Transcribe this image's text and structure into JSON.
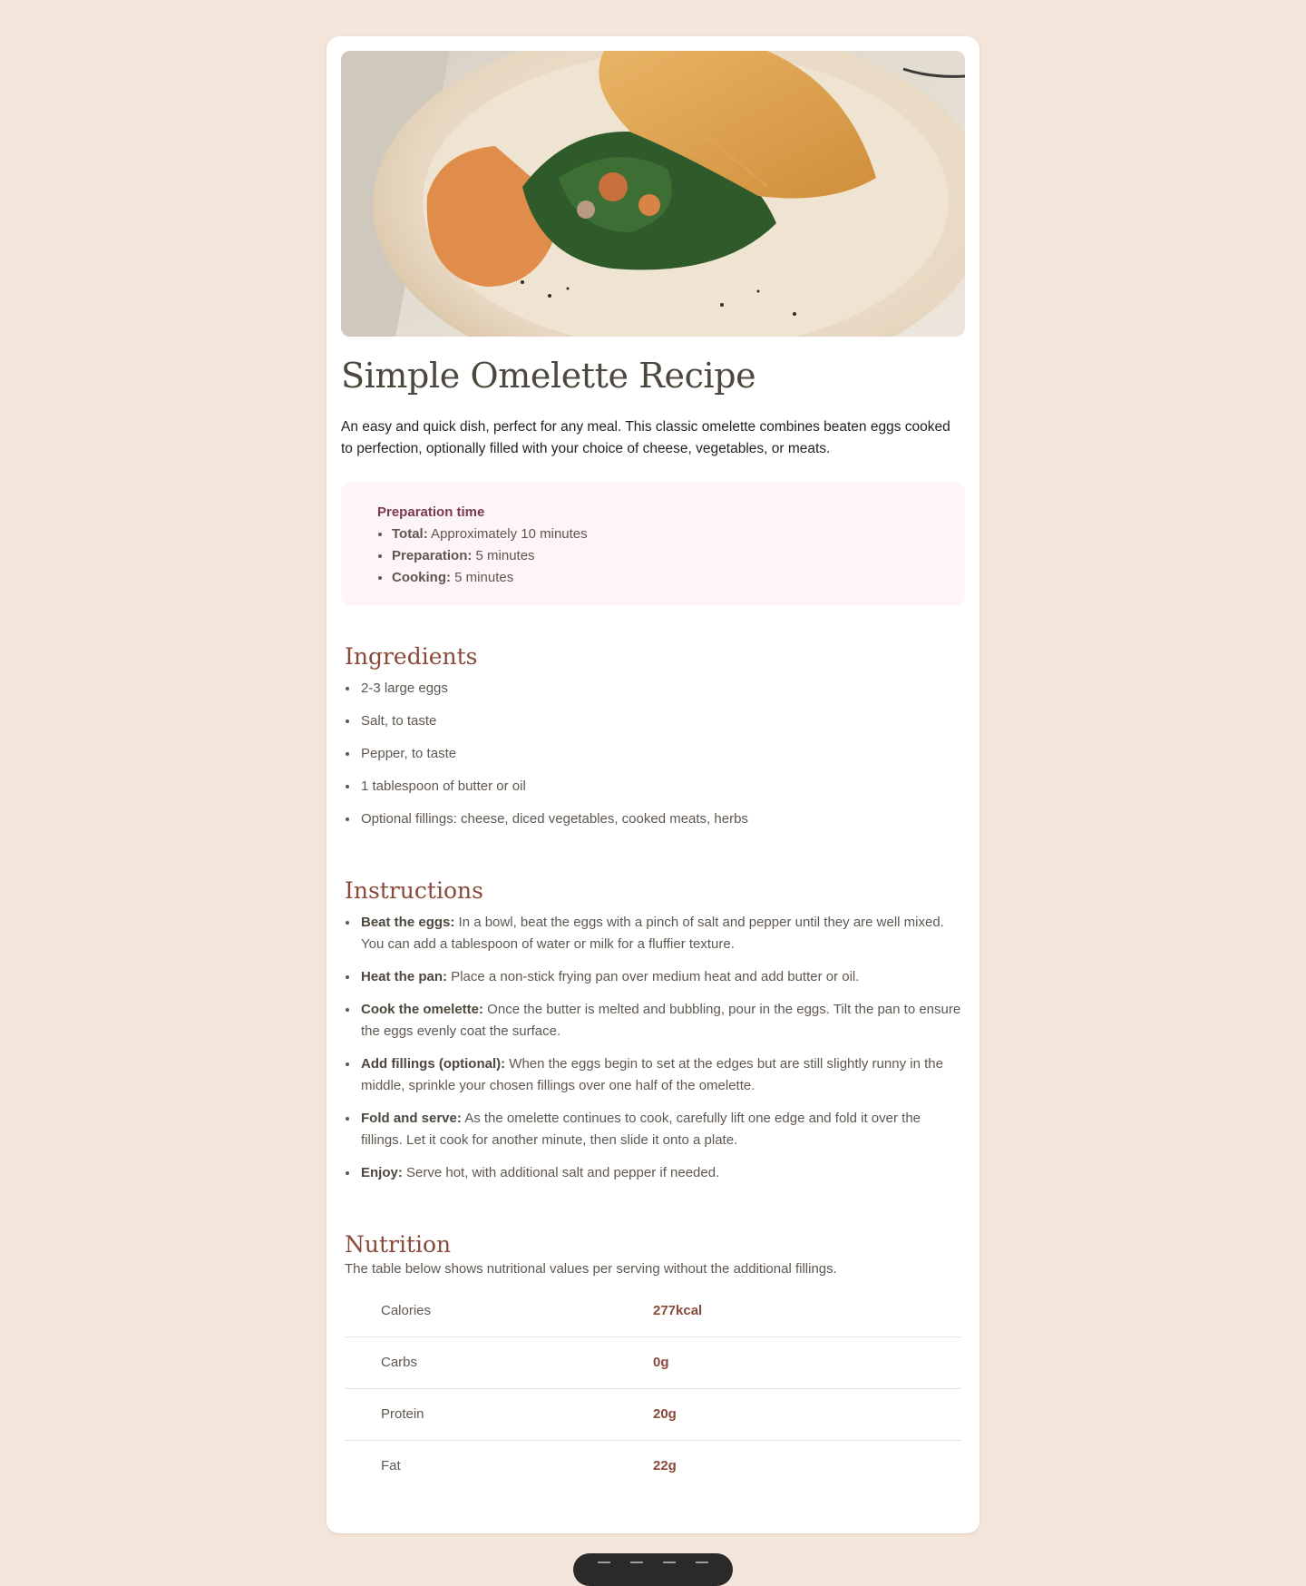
{
  "recipe": {
    "image_alt": "Omelette folded over spinach and fillings on a plate",
    "title": "Simple Omelette Recipe",
    "intro": "An easy and quick dish, perfect for any meal. This classic omelette combines beaten eggs cooked to perfection, optionally filled with your choice of cheese, vegetables, or meats.",
    "prep": {
      "title": "Preparation time",
      "items": [
        {
          "label": "Total:",
          "text": " Approximately 10 minutes"
        },
        {
          "label": "Preparation:",
          "text": " 5 minutes"
        },
        {
          "label": "Cooking:",
          "text": " 5 minutes"
        }
      ]
    },
    "ingredients": {
      "heading": "Ingredients",
      "items": [
        "2-3 large eggs",
        "Salt, to taste",
        "Pepper, to taste",
        "1 tablespoon of butter or oil",
        "Optional fillings: cheese, diced vegetables, cooked meats, herbs"
      ]
    },
    "instructions": {
      "heading": "Instructions",
      "items": [
        {
          "label": "Beat the eggs:",
          "text": " In a bowl, beat the eggs with a pinch of salt and pepper until they are well mixed. You can add a tablespoon of water or milk for a fluffier texture."
        },
        {
          "label": "Heat the pan:",
          "text": " Place a non-stick frying pan over medium heat and add butter or oil."
        },
        {
          "label": "Cook the omelette:",
          "text": " Once the butter is melted and bubbling, pour in the eggs. Tilt the pan to ensure the eggs evenly coat the surface."
        },
        {
          "label": "Add fillings (optional):",
          "text": " When the eggs begin to set at the edges but are still slightly runny in the middle, sprinkle your chosen fillings over one half of the omelette."
        },
        {
          "label": "Fold and serve:",
          "text": " As the omelette continues to cook, carefully lift one edge and fold it over the fillings. Let it cook for another minute, then slide it onto a plate."
        },
        {
          "label": "Enjoy:",
          "text": " Serve hot, with additional salt and pepper if needed."
        }
      ]
    },
    "nutrition": {
      "heading": "Nutrition",
      "note": "The table below shows nutritional values per serving without the additional fillings.",
      "rows": [
        {
          "label": "Calories",
          "value": "277kcal"
        },
        {
          "label": "Carbs",
          "value": "0g"
        },
        {
          "label": "Protein",
          "value": "20g"
        },
        {
          "label": "Fat",
          "value": "22g"
        }
      ]
    }
  },
  "colors": {
    "page_background": "#f3e5d9",
    "card_background": "#ffffff",
    "heading_brown": "#8a4a3a",
    "title_dark": "#4d473e",
    "prep_background": "#fdf5f8",
    "prep_title": "#7c3954",
    "body_text": "#5f574f"
  },
  "toolbar": {
    "icons": [
      "toolbar-icon-1",
      "toolbar-icon-2",
      "toolbar-icon-3",
      "toolbar-icon-4"
    ]
  }
}
